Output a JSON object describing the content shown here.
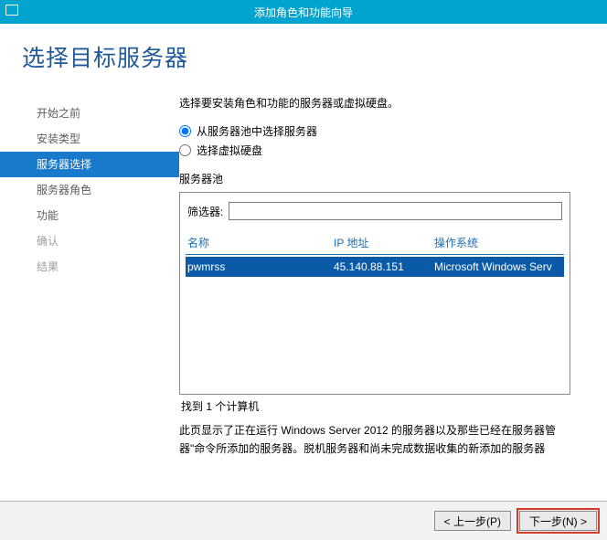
{
  "window": {
    "title": "添加角色和功能向导"
  },
  "header": {
    "title": "选择目标服务器"
  },
  "sidebar": {
    "items": [
      {
        "label": "开始之前",
        "dim": false
      },
      {
        "label": "安装类型",
        "dim": false
      },
      {
        "label": "服务器选择",
        "dim": false,
        "active": true
      },
      {
        "label": "服务器角色",
        "dim": false
      },
      {
        "label": "功能",
        "dim": false
      },
      {
        "label": "确认",
        "dim": true
      },
      {
        "label": "结果",
        "dim": true
      }
    ]
  },
  "main": {
    "intro": "选择要安装角色和功能的服务器或虚拟硬盘。",
    "radio_pool": "从服务器池中选择服务器",
    "radio_vhd": "选择虚拟硬盘",
    "selected_radio": "pool",
    "pool_label": "服务器池",
    "filter_label": "筛选器:",
    "filter_value": "",
    "table": {
      "headers": {
        "name": "名称",
        "ip": "IP 地址",
        "os": "操作系统"
      },
      "rows": [
        {
          "name": "pwmrss",
          "ip": "45.140.88.151",
          "os": "Microsoft Windows Serv"
        }
      ]
    },
    "found": "找到 1 个计算机",
    "desc1": "此页显示了正在运行 Windows Server 2012 的服务器以及那些已经在服务器管",
    "desc2": "器\"命令所添加的服务器。脱机服务器和尚未完成数据收集的新添加的服务器"
  },
  "footer": {
    "prev": "< 上一步(P)",
    "next": "下一步(N) >"
  }
}
